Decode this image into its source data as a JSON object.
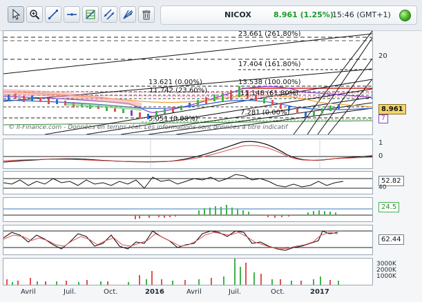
{
  "toolbar": {
    "tools": [
      {
        "name": "pointer-tool",
        "icon": "cursor-arrow-icon"
      },
      {
        "name": "zoom-tool",
        "icon": "magnifier-plus-icon"
      },
      {
        "name": "trendline-tool",
        "icon": "diagonal-line-icon"
      },
      {
        "name": "horizontal-line-tool",
        "icon": "horizontal-line-icon"
      },
      {
        "name": "fibonacci-tool",
        "icon": "fibonacci-grid-icon"
      },
      {
        "name": "channel-tool",
        "icon": "parallel-lines-icon"
      },
      {
        "name": "fan-tool",
        "icon": "fan-lines-icon"
      },
      {
        "name": "delete-tool",
        "icon": "trash-icon"
      }
    ]
  },
  "quote": {
    "symbol": "NICOX",
    "price_change": "8.961 (1.25%)",
    "time": "15:46 (GMT+1)",
    "status_color": "#3aa81c"
  },
  "main_chart": {
    "fib_levels": [
      {
        "label": "23.661 (261.80%)"
      },
      {
        "label": "17.404 (161.80%)"
      },
      {
        "label": "13.621 (0.00%)"
      },
      {
        "label": "13.538 (100.00%)"
      },
      {
        "label": "11.742 (23.60%)"
      },
      {
        "label": "11.148 (61.80%)"
      },
      {
        "label": "5.051 (0.00%)"
      },
      {
        "label": "7.281 (0.00%)"
      }
    ],
    "axis_labels": [
      "20"
    ],
    "current_price": "8.961",
    "secondary_price": "7",
    "watermark": "© ll-Finance.com - Données en temps réel. Les informations sont données à titre indicatif"
  },
  "indicators": {
    "macd": {
      "axis": [
        "1",
        "0"
      ]
    },
    "momentum": {
      "value": "52.82",
      "axis": [
        "40"
      ]
    },
    "histogram": {
      "value": "24.5"
    },
    "stochastic": {
      "value": "62.44"
    },
    "volume": {
      "axis": [
        "3000K",
        "2000K",
        "1000K"
      ]
    }
  },
  "time_axis": [
    "Avril",
    "Juil.",
    "Oct.",
    "2016",
    "Avril",
    "Juil.",
    "Oct.",
    "2017"
  ],
  "colors": {
    "price_box_bg": "#f3d36b",
    "histogram_box": "#3fb24a",
    "red_line": "#d62020",
    "green": "#3fb24a"
  }
}
